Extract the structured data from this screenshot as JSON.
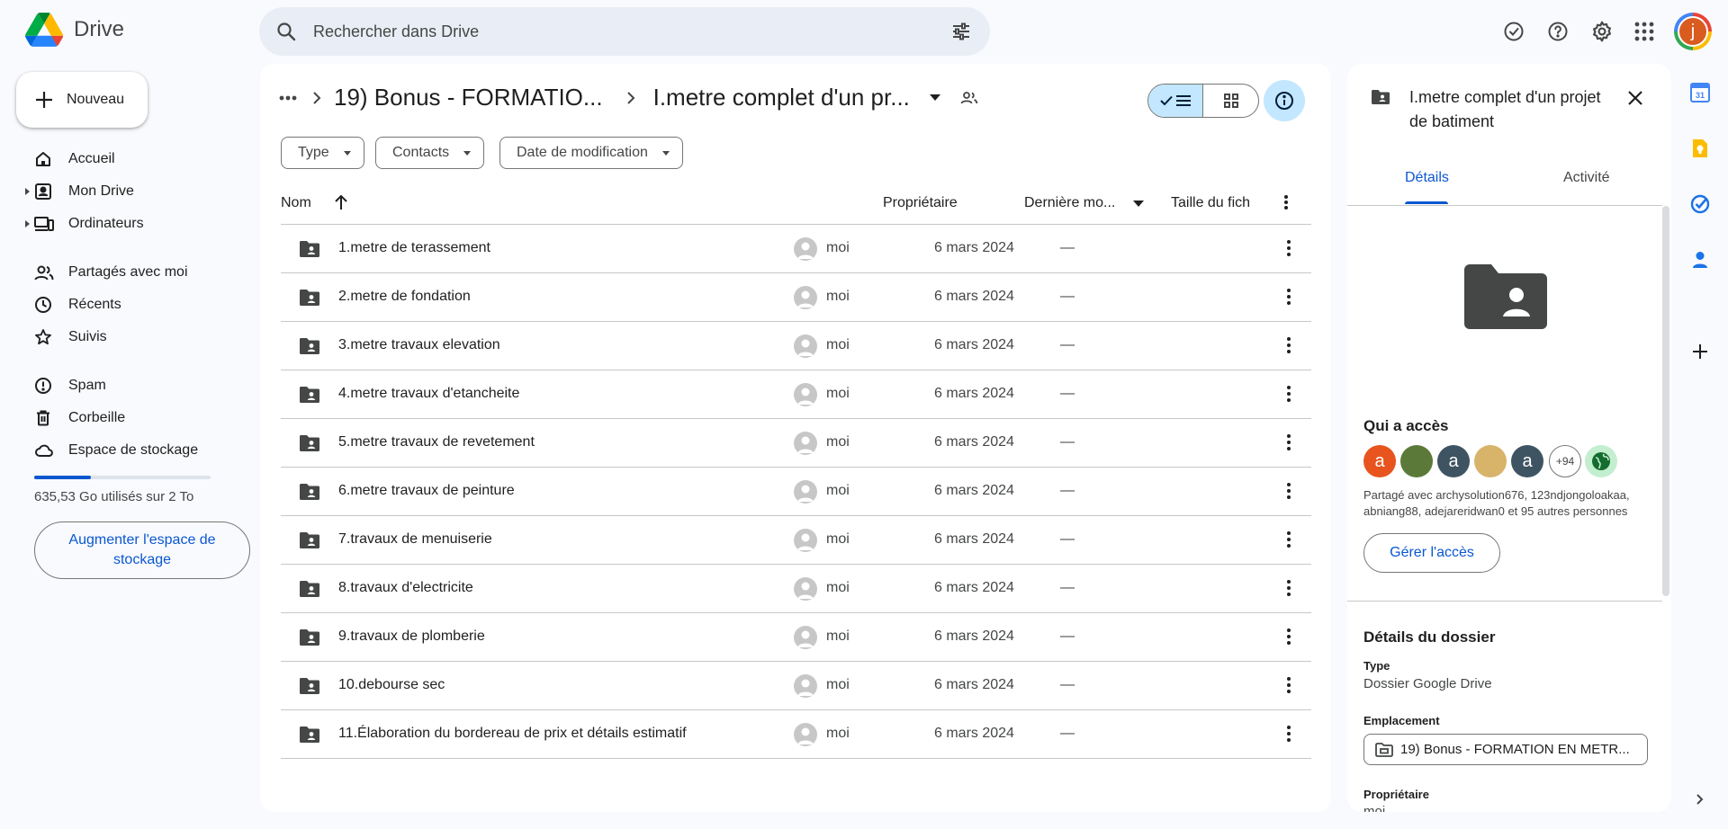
{
  "app": {
    "name": "Drive"
  },
  "search": {
    "placeholder": "Rechercher dans Drive"
  },
  "sidebar": {
    "new_label": "Nouveau",
    "items": [
      {
        "label": "Accueil"
      },
      {
        "label": "Mon Drive"
      },
      {
        "label": "Ordinateurs"
      },
      {
        "label": "Partagés avec moi"
      },
      {
        "label": "Récents"
      },
      {
        "label": "Suivis"
      },
      {
        "label": "Spam"
      },
      {
        "label": "Corbeille"
      },
      {
        "label": "Espace de stockage"
      }
    ],
    "storage_text": "635,53 Go utilisés sur 2 To",
    "storage_fraction": 0.32,
    "upgrade_label": "Augmenter l'espace de stockage"
  },
  "user": {
    "initial": "j"
  },
  "breadcrumb": {
    "parent": "19) Bonus - FORMATIO...",
    "current": "I.metre complet d'un pr..."
  },
  "filters": {
    "type": "Type",
    "contacts": "Contacts",
    "date": "Date de modification"
  },
  "table": {
    "headers": {
      "name": "Nom",
      "owner": "Propriétaire",
      "modified": "Dernière mo...",
      "size": "Taille du fich"
    },
    "rows": [
      {
        "name": "1.metre de terassement",
        "owner": "moi",
        "date": "6 mars 2024",
        "size": "—"
      },
      {
        "name": "2.metre de fondation",
        "owner": "moi",
        "date": "6 mars 2024",
        "size": "—"
      },
      {
        "name": "3.metre travaux elevation",
        "owner": "moi",
        "date": "6 mars 2024",
        "size": "—"
      },
      {
        "name": "4.metre travaux d'etancheite",
        "owner": "moi",
        "date": "6 mars 2024",
        "size": "—"
      },
      {
        "name": "5.metre travaux de revetement",
        "owner": "moi",
        "date": "6 mars 2024",
        "size": "—"
      },
      {
        "name": "6.metre travaux de peinture",
        "owner": "moi",
        "date": "6 mars 2024",
        "size": "—"
      },
      {
        "name": "7.travaux de menuiserie",
        "owner": "moi",
        "date": "6 mars 2024",
        "size": "—"
      },
      {
        "name": "8.travaux d'electricite",
        "owner": "moi",
        "date": "6 mars 2024",
        "size": "—"
      },
      {
        "name": "9.travaux de plomberie",
        "owner": "moi",
        "date": "6 mars 2024",
        "size": "—"
      },
      {
        "name": "10.debourse sec",
        "owner": "moi",
        "date": "6 mars 2024",
        "size": "—"
      },
      {
        "name": "11.Élaboration du bordereau de prix et détails estimatif",
        "owner": "moi",
        "date": "6 mars 2024",
        "size": "—"
      }
    ]
  },
  "details": {
    "title": "I.metre complet d'un projet de batiment",
    "tabs": {
      "details": "Détails",
      "activity": "Activité"
    },
    "access_heading": "Qui a accès",
    "access_avatars": [
      {
        "initial": "a",
        "color": "#e8541e"
      },
      {
        "initial": "",
        "color": "#5b7a3a"
      },
      {
        "initial": "a",
        "color": "#3f5462"
      },
      {
        "initial": "",
        "color": "#d8b46a"
      },
      {
        "initial": "a",
        "color": "#3f5462"
      }
    ],
    "access_more": "+94",
    "shared_text": "Partagé avec archysolution676, 123ndjongoloakaa, abniang88, adejareridwan0 et 95 autres personnes",
    "manage_label": "Gérer l'accès",
    "folder_heading": "Détails du dossier",
    "type_label": "Type",
    "type_value": "Dossier Google Drive",
    "location_label": "Emplacement",
    "location_value": "19) Bonus - FORMATION EN METR...",
    "owner_label": "Propriétaire",
    "owner_value": "moi"
  },
  "colors": {
    "accent": "#0b57d0",
    "selected": "#c2e7ff",
    "search_bg": "#e9eef6"
  }
}
